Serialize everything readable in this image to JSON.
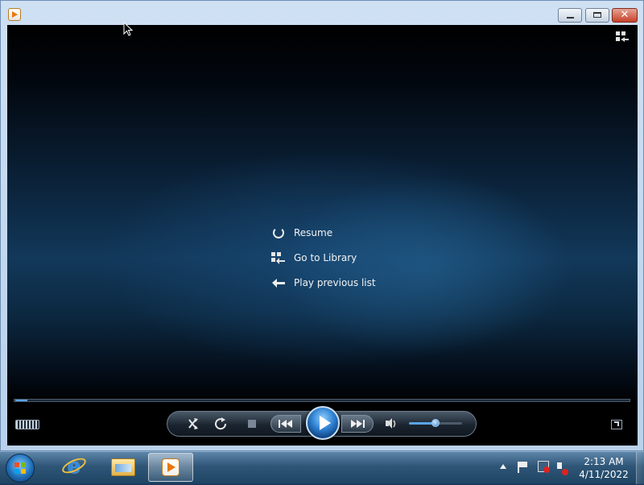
{
  "window": {
    "title": "",
    "controls": {
      "minimize_icon": "minimize-icon",
      "maximize_icon": "maximize-icon",
      "close_label": "✕"
    }
  },
  "player": {
    "menu": [
      {
        "icon": "resume-icon",
        "label": "Resume"
      },
      {
        "icon": "library-icon",
        "label": "Go to Library"
      },
      {
        "icon": "back-arrow-icon",
        "label": "Play previous list"
      }
    ],
    "seek_progress": 0.02,
    "volume": 0.5
  },
  "taskbar": {
    "pinned": [
      {
        "icon": "internet-explorer-icon"
      },
      {
        "icon": "windows-explorer-icon"
      },
      {
        "icon": "windows-media-player-icon",
        "active": true
      }
    ],
    "clock": {
      "time": "2:13 AM",
      "date": "4/11/2022"
    }
  },
  "colors": {
    "accent": "#5aa3e6",
    "taskbar": "#2f5677",
    "close": "#c7412a"
  }
}
